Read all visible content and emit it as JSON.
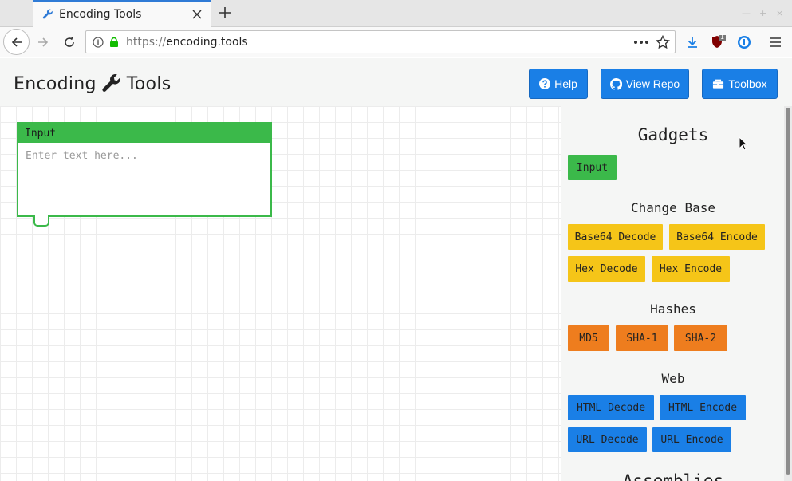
{
  "browser": {
    "tab_title": "Encoding Tools",
    "url_scheme": "https://",
    "url_host": "encoding.tools",
    "addon_badge": "1"
  },
  "header": {
    "brand_left": "Encoding",
    "brand_right": "Tools",
    "help_label": "Help",
    "repo_label": "View Repo",
    "toolbox_label": "Toolbox"
  },
  "canvas": {
    "input_block": {
      "title": "Input",
      "placeholder": "Enter text here..."
    }
  },
  "sidebar": {
    "title": "Gadgets",
    "input_label": "Input",
    "change_base": {
      "title": "Change Base",
      "items": [
        "Base64 Decode",
        "Base64 Encode",
        "Hex Decode",
        "Hex Encode"
      ]
    },
    "hashes": {
      "title": "Hashes",
      "items": [
        "MD5",
        "SHA-1",
        "SHA-2"
      ]
    },
    "web": {
      "title": "Web",
      "items": [
        "HTML Decode",
        "HTML Encode",
        "URL Decode",
        "URL Encode"
      ]
    },
    "next_section_title": "Assemblies"
  },
  "colors": {
    "accent_blue": "#1a7fe6",
    "input_green": "#3bb94a",
    "base_yellow": "#f5c518",
    "hash_orange": "#ee7d1e"
  }
}
